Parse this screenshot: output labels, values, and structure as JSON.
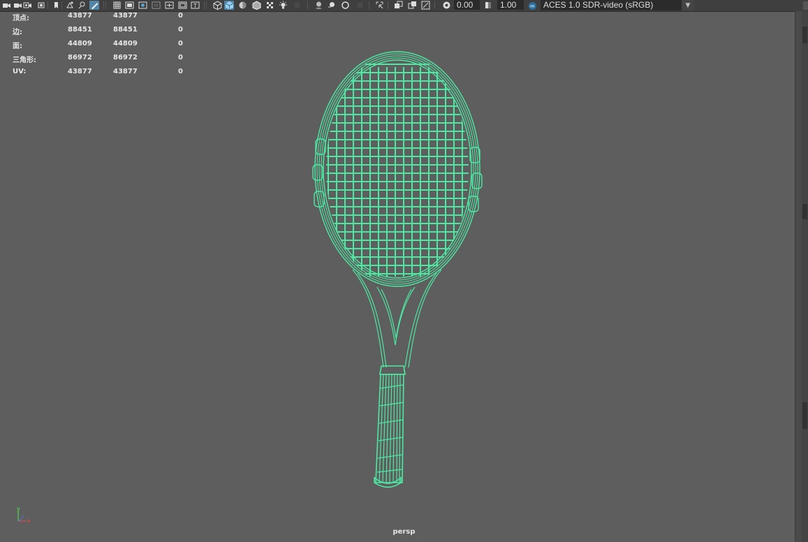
{
  "toolbar": {
    "exposure_value": "0.00",
    "gamma_value": "1.00",
    "color_space": "ACES 1.0 SDR-video (sRGB)",
    "icons": [
      "camera-icon",
      "camera-attributes-icon",
      "bookmark-icon",
      "image-plane-icon",
      "grid-toggle-icon",
      "film-gate-icon",
      "resolution-gate-icon",
      "safe-action-icon",
      "wireframe-icon",
      "smooth-shade-icon",
      "texture-icon",
      "lights-icon",
      "shadows-icon",
      "ambient-occlusion-icon",
      "isolate-select-icon",
      "xray-icon",
      "exposure-icon",
      "gamma-icon",
      "color-management-icon"
    ]
  },
  "hud": {
    "rows": [
      {
        "label": "顶点:",
        "v1": "43877",
        "v2": "43877",
        "v3": "0"
      },
      {
        "label": "边:",
        "v1": "88451",
        "v2": "88451",
        "v3": "0"
      },
      {
        "label": "面:",
        "v1": "44809",
        "v2": "44809",
        "v3": "0"
      },
      {
        "label": "三角形:",
        "v1": "86972",
        "v2": "86972",
        "v3": "0"
      },
      {
        "label": "UV:",
        "v1": "43877",
        "v2": "43877",
        "v3": "0"
      }
    ]
  },
  "viewport": {
    "panel_name": "persp",
    "wireframe_color": "#4de8a2",
    "background_color": "#5e5e5e",
    "axis": {
      "y": "y",
      "x": "x",
      "z": "z"
    }
  }
}
